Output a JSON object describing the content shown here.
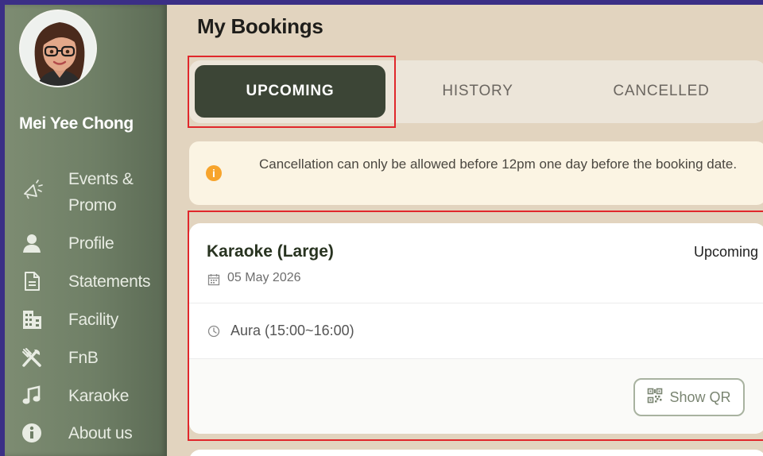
{
  "user": {
    "name": "Mei Yee Chong"
  },
  "sidebar": {
    "items": [
      {
        "label_line1": "Events &",
        "label_line2": "Promo",
        "icon": "megaphone-icon"
      },
      {
        "label": "Profile",
        "icon": "person-icon"
      },
      {
        "label": "Statements",
        "icon": "document-icon"
      },
      {
        "label": "Facility",
        "icon": "building-icon"
      },
      {
        "label": "FnB",
        "icon": "utensils-icon"
      },
      {
        "label": "Karaoke",
        "icon": "music-note-icon"
      },
      {
        "label": "About us",
        "icon": "info-icon"
      }
    ]
  },
  "page": {
    "title": "My Bookings"
  },
  "tabs": [
    {
      "label": "UPCOMING",
      "active": true
    },
    {
      "label": "HISTORY",
      "active": false
    },
    {
      "label": "CANCELLED",
      "active": false
    }
  ],
  "notice": {
    "icon": "info-icon",
    "text": "Cancellation can only be allowed before 12pm one day before the booking date."
  },
  "booking": {
    "title": "Karaoke (Large)",
    "status": "Upcoming",
    "date": "05 May 2026",
    "slot": "Aura (15:00~16:00)",
    "qr_label": "Show QR"
  },
  "colors": {
    "active_tab": "#3c4536",
    "highlight": "#e0272b",
    "notice_icon": "#f7a42c",
    "page_bg": "#e2d4bf",
    "sidebar_bg": "#6f7f66"
  }
}
